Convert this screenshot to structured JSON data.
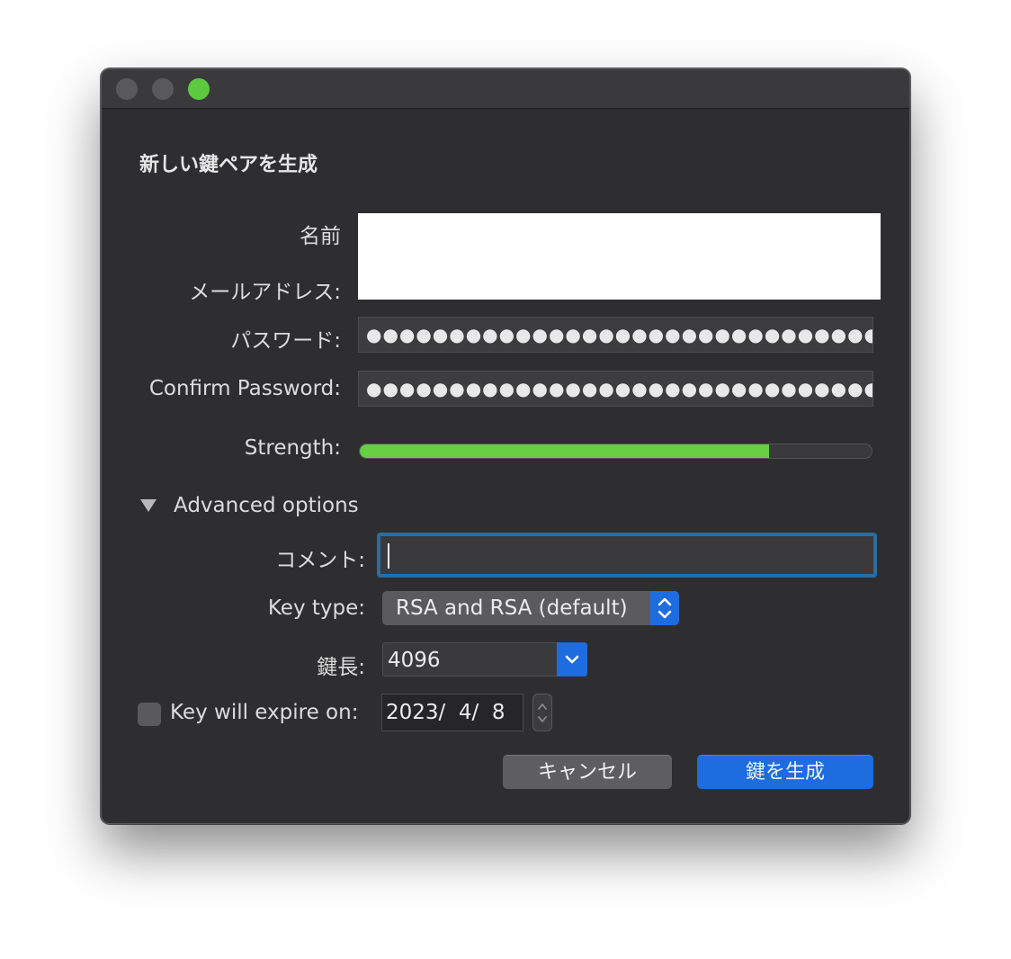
{
  "dialog": {
    "title": "新しい鍵ペアを生成"
  },
  "fields": {
    "name_label": "名前",
    "email_label": "メールアドレス:",
    "password_label": "パスワード:",
    "password_value": "●●●●●●●●●●●●●●●●●●●●●●●●●●●●●●●●●●●●●●●●●",
    "confirm_label": "Confirm Password:",
    "confirm_value": "●●●●●●●●●●●●●●●●●●●●●●●●●●●●●●●●●●●●●●●●●",
    "strength_label": "Strength:",
    "strength_fraction": 0.8
  },
  "advanced": {
    "toggle_label": "Advanced options",
    "comment_label": "コメント:",
    "comment_value": "",
    "keytype_label": "Key type:",
    "keytype_value": "RSA and RSA (default)",
    "keylength_label": "鍵長:",
    "keylength_value": "4096",
    "expire_label": "Key will expire on:",
    "expire_checked": false,
    "expire_date": "2023/  4/  8"
  },
  "buttons": {
    "cancel": "キャンセル",
    "generate": "鍵を生成"
  },
  "colors": {
    "accent": "#1d6ce0",
    "strength": "#66cf43",
    "window_bg": "#2e2e30"
  },
  "icons": {
    "close": "close-traffic-light",
    "minimize": "minimize-traffic-light",
    "zoom": "zoom-traffic-light",
    "disclosure": "disclosure-triangle-icon",
    "select_stepper": "up-down-chevron-icon",
    "combo_arrow": "chevron-down-icon",
    "date_stepper": "stepper-icon"
  }
}
